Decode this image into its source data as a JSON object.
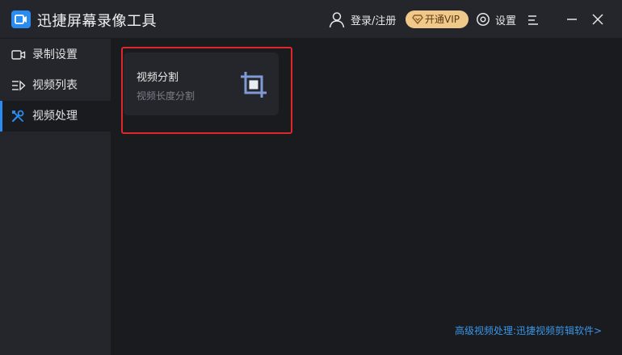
{
  "app": {
    "title": "迅捷屏幕录像工具"
  },
  "header": {
    "login_label": "登录/注册",
    "vip_label": "开通VIP",
    "settings_label": "设置"
  },
  "sidebar": {
    "items": [
      {
        "label": "录制设置",
        "icon": "camera-icon"
      },
      {
        "label": "视频列表",
        "icon": "list-icon"
      },
      {
        "label": "视频处理",
        "icon": "tools-icon",
        "active": true
      }
    ]
  },
  "main": {
    "card": {
      "title": "视频分割",
      "subtitle": "视频长度分割",
      "icon": "crop-icon"
    },
    "promo_link": "高级视频处理:迅捷视频剪辑软件>"
  },
  "colors": {
    "accent": "#2a8cf0",
    "vip_gold": "#f0c88a",
    "highlight": "#e0262a",
    "link": "#3b96e8"
  }
}
